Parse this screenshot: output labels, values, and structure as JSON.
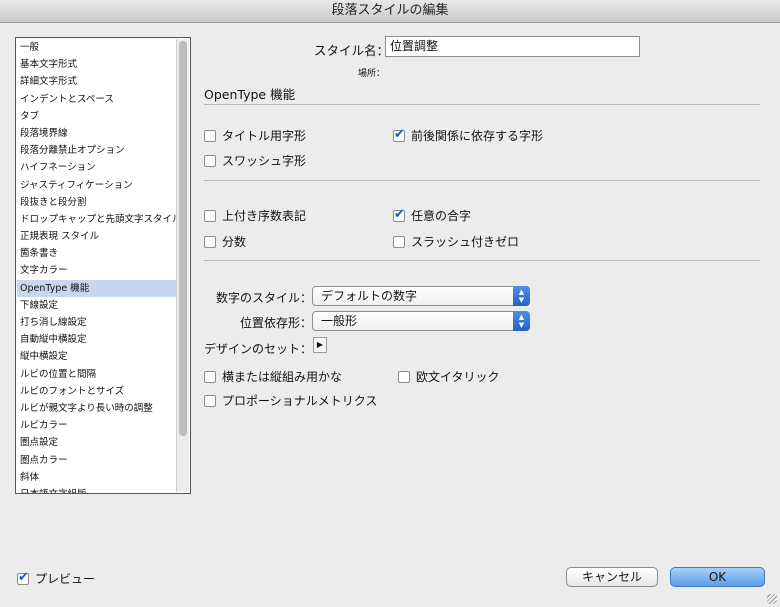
{
  "window": {
    "title": "段落スタイルの編集"
  },
  "sidebar": {
    "items": [
      "一般",
      "基本文字形式",
      "詳細文字形式",
      "インデントとスペース",
      "タブ",
      "段落境界線",
      "段落分離禁止オプション",
      "ハイフネーション",
      "ジャスティフィケーション",
      "段抜きと段分割",
      "ドロップキャップと先頭文字スタイル",
      "正規表現 スタイル",
      "箇条書き",
      "文字カラー",
      "OpenType 機能",
      "下線設定",
      "打ち消し線設定",
      "自動縦中横設定",
      "縦中横設定",
      "ルビの位置と間隔",
      "ルビのフォントとサイズ",
      "ルビが親文字より長い時の調整",
      "ルビカラー",
      "圏点設定",
      "圏点カラー",
      "斜体",
      "日本語文字組版"
    ],
    "selected": "OpenType 機能"
  },
  "style_name": {
    "label": "スタイル名：",
    "value": "位置調整"
  },
  "location": {
    "label": "場所："
  },
  "section_title": "OpenType 機能",
  "checkboxes": {
    "titling": {
      "label": "タイトル用字形",
      "checked": false
    },
    "contextual": {
      "label": "前後関係に依存する字形",
      "checked": true
    },
    "swash": {
      "label": "スワッシュ字形",
      "checked": false
    },
    "ordinal": {
      "label": "上付き序数表記",
      "checked": false
    },
    "discretionary": {
      "label": "任意の合字",
      "checked": true
    },
    "fractions": {
      "label": "分数",
      "checked": false
    },
    "slashed_zero": {
      "label": "スラッシュ付きゼロ",
      "checked": false
    },
    "vertical_kana": {
      "label": "横または縦組み用かな",
      "checked": false
    },
    "roman_italic": {
      "label": "欧文イタリック",
      "checked": false
    },
    "proportional": {
      "label": "プロポーショナルメトリクス",
      "checked": false
    }
  },
  "figure_style": {
    "label": "数字のスタイル：",
    "value": "デフォルトの数字"
  },
  "positional_form": {
    "label": "位置依存形：",
    "value": "一般形"
  },
  "stylistic_sets": {
    "label": "デザインのセット："
  },
  "preview": {
    "label": "プレビュー",
    "checked": true
  },
  "buttons": {
    "cancel": "キャンセル",
    "ok": "OK"
  }
}
